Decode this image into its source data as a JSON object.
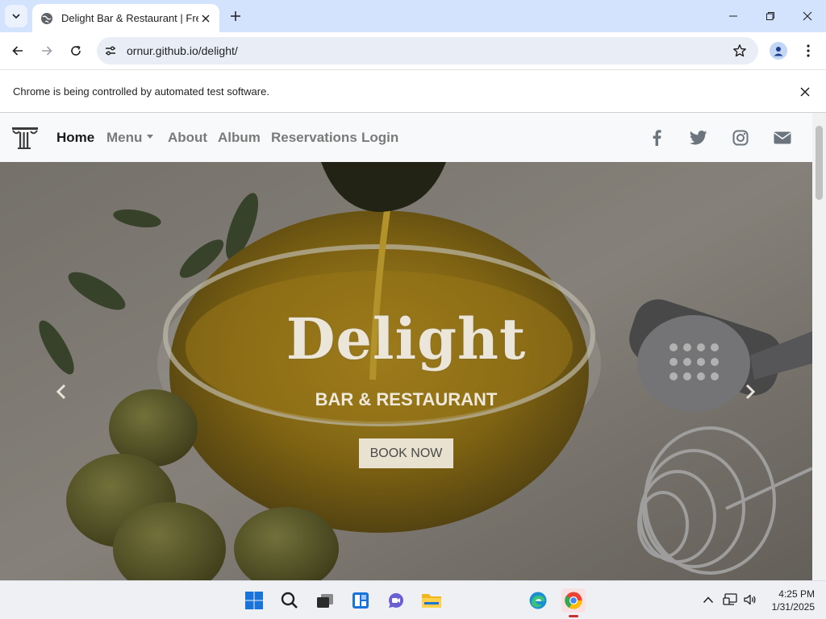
{
  "browser": {
    "tab_title": "Delight Bar & Restaurant | Free",
    "url": "ornur.github.io/delight/",
    "infobar_message": "Chrome is being controlled by automated test software."
  },
  "site": {
    "nav": {
      "items": [
        {
          "label": "Home",
          "active": true
        },
        {
          "label": "Menu",
          "dropdown": true
        },
        {
          "label": "About"
        },
        {
          "label": "Album"
        },
        {
          "label": "Reservations"
        },
        {
          "label": "Login"
        }
      ],
      "social_icons": [
        "facebook-icon",
        "twitter-icon",
        "instagram-icon",
        "envelope-icon"
      ]
    },
    "hero": {
      "title": "Delight",
      "subtitle": "BAR & RESTAURANT",
      "button_label": "BOOK NOW"
    }
  },
  "taskbar": {
    "time": "4:25 PM",
    "date": "1/31/2025"
  },
  "colors": {
    "tabstrip": "#d3e3fd",
    "omnibox": "#e9eef6",
    "site_nav_bg": "#f8f9fa",
    "nav_active": "#1a1a1a",
    "nav_muted": "#7a7a7a"
  }
}
